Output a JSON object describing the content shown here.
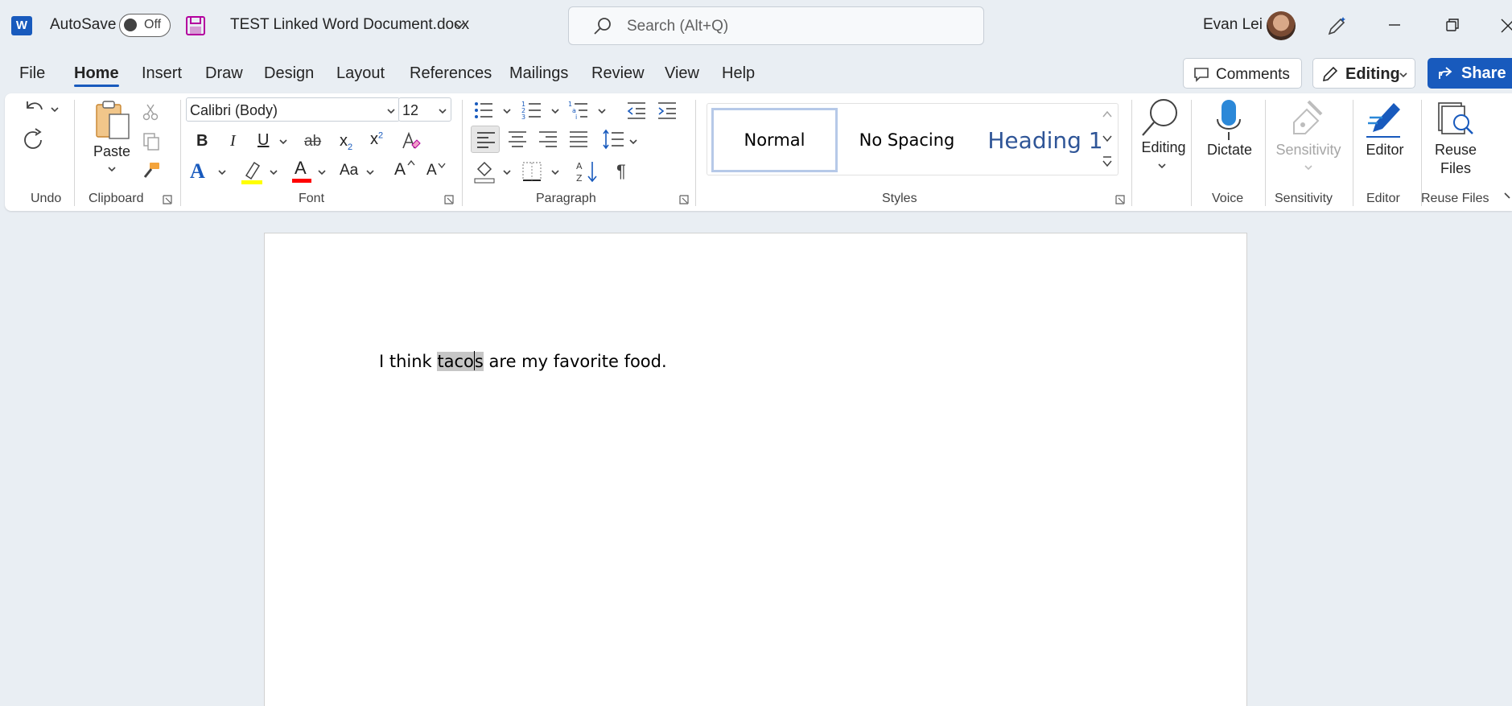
{
  "titlebar": {
    "app_letter": "W",
    "autosave_label": "AutoSave",
    "autosave_state": "Off",
    "document_title": "TEST Linked Word Document.docx",
    "search_placeholder": "Search (Alt+Q)",
    "user_name": "Evan Lei"
  },
  "tabs": [
    {
      "label": "File"
    },
    {
      "label": "Home",
      "active": true
    },
    {
      "label": "Insert"
    },
    {
      "label": "Draw"
    },
    {
      "label": "Design"
    },
    {
      "label": "Layout"
    },
    {
      "label": "References"
    },
    {
      "label": "Mailings"
    },
    {
      "label": "Review"
    },
    {
      "label": "View"
    },
    {
      "label": "Help"
    }
  ],
  "actions": {
    "comments": "Comments",
    "editing": "Editing",
    "share": "Share"
  },
  "ribbon": {
    "undo_group": "Undo",
    "clipboard": {
      "group": "Clipboard",
      "paste": "Paste"
    },
    "font": {
      "group": "Font",
      "font_name": "Calibri (Body)",
      "font_size": "12",
      "bold": "B",
      "italic": "I",
      "underline": "U",
      "strike": "ab",
      "subscript": "x",
      "superscript": "x",
      "subscript_mark": "2",
      "superscript_mark": "2",
      "text_effects": "A",
      "font_color": "A",
      "change_case": "Aa",
      "grow": "A",
      "shrink": "A"
    },
    "paragraph": {
      "group": "Paragraph",
      "pilcrow": "¶"
    },
    "styles": {
      "group": "Styles",
      "items": [
        "Normal",
        "No Spacing",
        "Heading 1"
      ]
    },
    "editing": {
      "label": "Editing"
    },
    "voice": {
      "group": "Voice",
      "dictate": "Dictate"
    },
    "sensitivity": {
      "group": "Sensitivity",
      "button": "Sensitivity"
    },
    "editor": {
      "group": "Editor",
      "button": "Editor"
    },
    "reuse": {
      "group": "Reuse Files",
      "button_line1": "Reuse",
      "button_line2": "Files"
    }
  },
  "document": {
    "before": "I think ",
    "sel_a": "taco",
    "sel_b": "s",
    "after": " are my favorite food."
  },
  "colors": {
    "accent": "#185abd",
    "highlight": "#ffff00",
    "font_color": "#ff0000",
    "heading": "#2f5597"
  }
}
